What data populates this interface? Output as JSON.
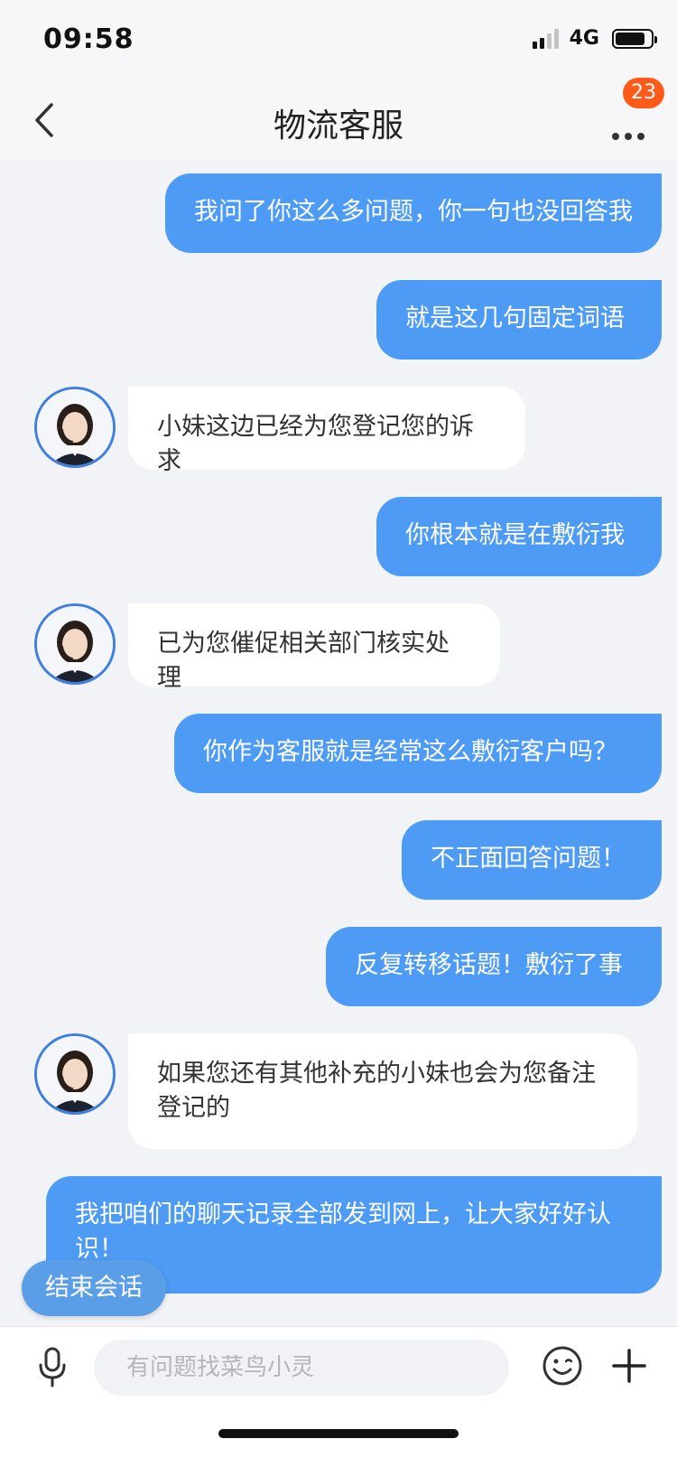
{
  "status_bar": {
    "time": "09:58",
    "network": "4G",
    "battery_level": 0.85
  },
  "header": {
    "title": "物流客服",
    "badge_count": "23"
  },
  "messages": [
    {
      "side": "right",
      "text": "我问了你这么多问题，你一句也没回答我"
    },
    {
      "side": "right",
      "text": "就是这几句固定词语"
    },
    {
      "side": "left",
      "text": "小妹这边已经为您登记您的诉求"
    },
    {
      "side": "right",
      "text": "你根本就是在敷衍我"
    },
    {
      "side": "left",
      "text": "已为您催促相关部门核实处理"
    },
    {
      "side": "right",
      "text": "你作为客服就是经常这么敷衍客户吗？"
    },
    {
      "side": "right",
      "text": "不正面回答问题！"
    },
    {
      "side": "right",
      "text": "反复转移话题！敷衍了事"
    },
    {
      "side": "left",
      "text": "如果您还有其他补充的小妹也会为您备注登记的"
    },
    {
      "side": "right",
      "text": "我把咱们的聊天记录全部发到网上，让大家好好认识！"
    }
  ],
  "end_session_label": "结束会话",
  "input": {
    "placeholder": "有问题找菜鸟小灵",
    "value": ""
  },
  "colors": {
    "accent": "#4d9bf5",
    "badge": "#ff5a19",
    "background": "#f2f3f7"
  },
  "icons": {
    "back": "chevron-left-icon",
    "more": "more-dots-icon",
    "mic": "microphone-icon",
    "emoji": "emoji-icon",
    "plus": "plus-icon"
  }
}
